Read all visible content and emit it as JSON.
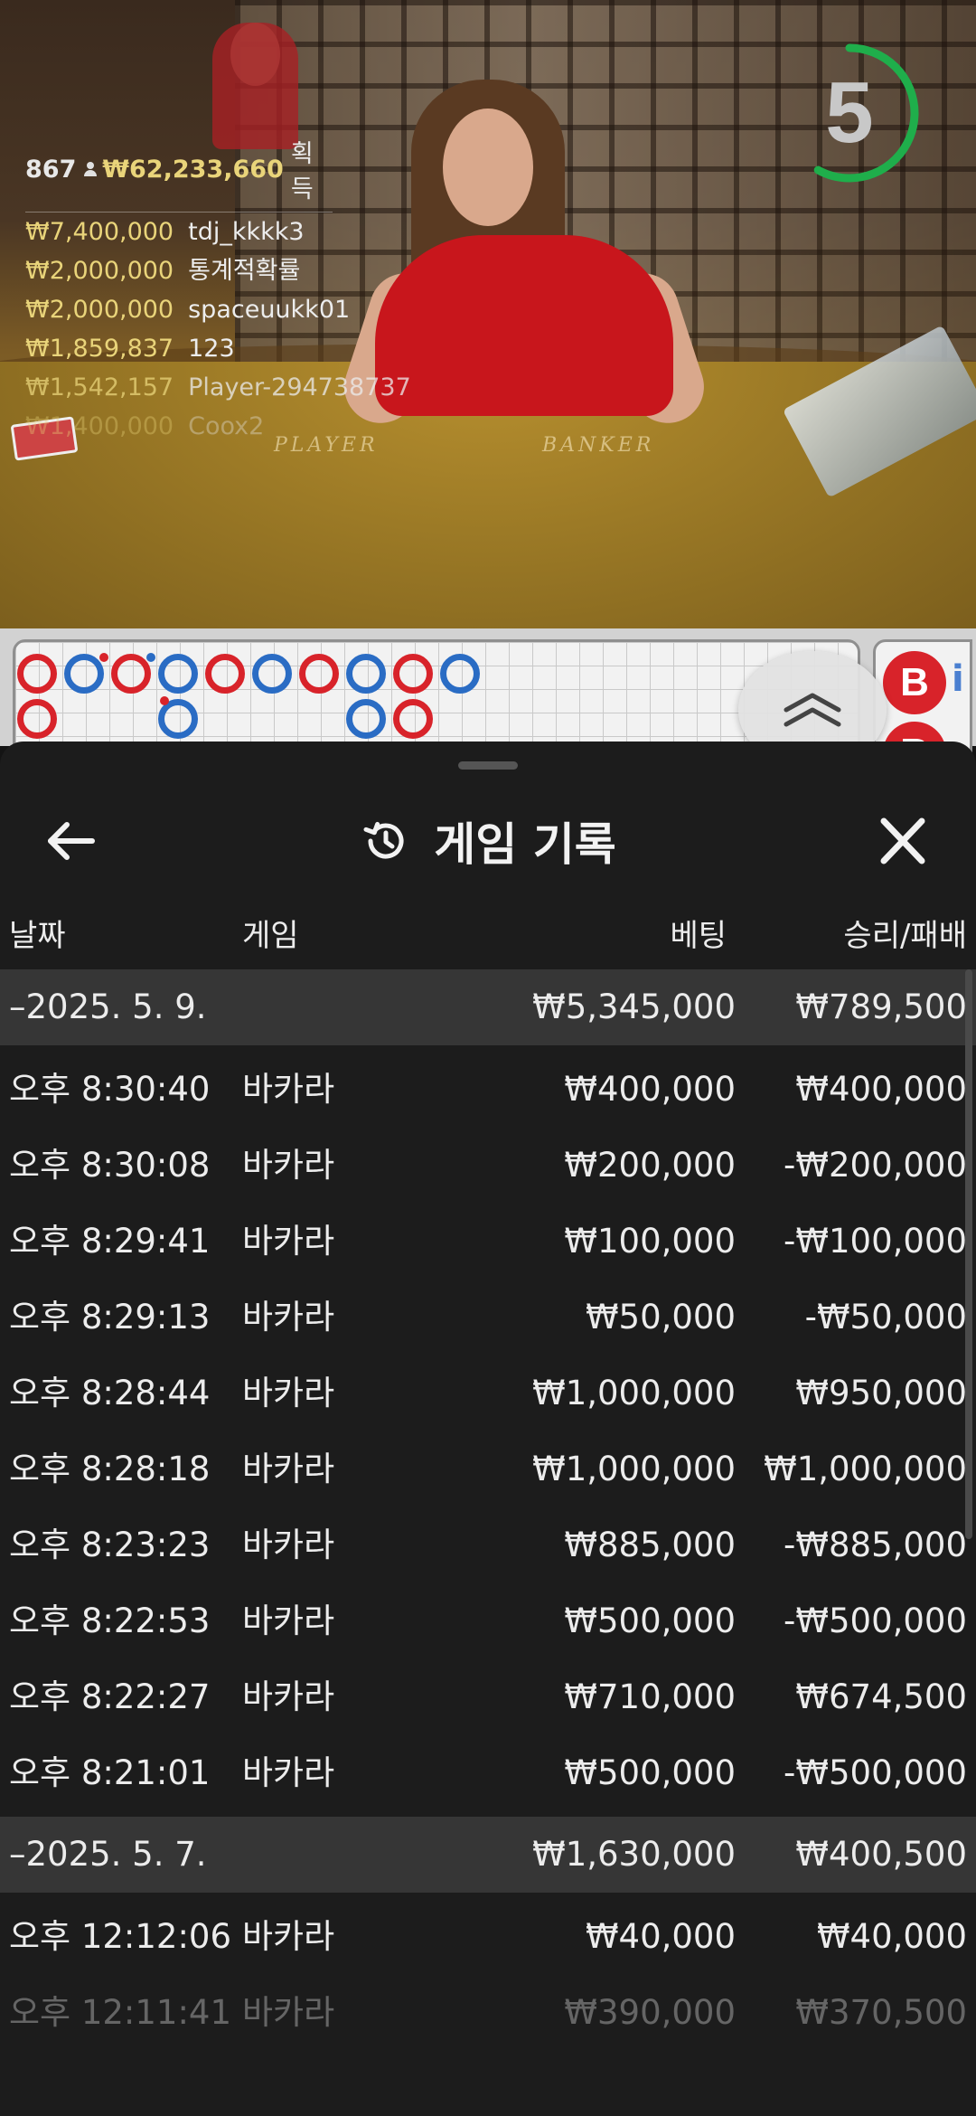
{
  "video": {
    "table_left": "PLAYER",
    "table_right": "BANKER",
    "countdown": "5",
    "countdown_progress": 0.58,
    "countdown_color": "#1fae4b"
  },
  "leaderboard": {
    "player_count": "867",
    "total": "₩62,233,660",
    "total_suffix": "획득",
    "winners": [
      {
        "amount": "₩7,400,000",
        "name": "tdj_kkkk3"
      },
      {
        "amount": "₩2,000,000",
        "name": "통계적확률"
      },
      {
        "amount": "₩2,000,000",
        "name": "spaceuukk01"
      },
      {
        "amount": "₩1,859,837",
        "name": "123"
      },
      {
        "amount": "₩1,542,157",
        "name": "Player-294738737"
      },
      {
        "amount": "₩1,400,000",
        "name": "Coox2"
      }
    ]
  },
  "roadmap": {
    "side_badge": "B",
    "banker_color": "#d8232a",
    "player_color": "#2a6cc4"
  },
  "panel": {
    "title": "게임 기록",
    "icons": {
      "back": "arrow-left-icon",
      "history": "history-icon",
      "close": "close-icon"
    },
    "columns": {
      "date": "날짜",
      "game": "게임",
      "bet": "베팅",
      "win_loss": "승리/패배"
    },
    "rows": [
      {
        "type": "date",
        "date": "–2025. 5. 9.",
        "game": "",
        "bet": "₩5,345,000",
        "win": "₩789,500"
      },
      {
        "type": "game",
        "date": "오후 8:30:40",
        "game": "바카라",
        "bet": "₩400,000",
        "win": "₩400,000"
      },
      {
        "type": "game",
        "date": "오후 8:30:08",
        "game": "바카라",
        "bet": "₩200,000",
        "win": "-₩200,000"
      },
      {
        "type": "game",
        "date": "오후 8:29:41",
        "game": "바카라",
        "bet": "₩100,000",
        "win": "-₩100,000"
      },
      {
        "type": "game",
        "date": "오후 8:29:13",
        "game": "바카라",
        "bet": "₩50,000",
        "win": "-₩50,000"
      },
      {
        "type": "game",
        "date": "오후 8:28:44",
        "game": "바카라",
        "bet": "₩1,000,000",
        "win": "₩950,000"
      },
      {
        "type": "game",
        "date": "오후 8:28:18",
        "game": "바카라",
        "bet": "₩1,000,000",
        "win": "₩1,000,000"
      },
      {
        "type": "game",
        "date": "오후 8:23:23",
        "game": "바카라",
        "bet": "₩885,000",
        "win": "-₩885,000"
      },
      {
        "type": "game",
        "date": "오후 8:22:53",
        "game": "바카라",
        "bet": "₩500,000",
        "win": "-₩500,000"
      },
      {
        "type": "game",
        "date": "오후 8:22:27",
        "game": "바카라",
        "bet": "₩710,000",
        "win": "₩674,500"
      },
      {
        "type": "game",
        "date": "오후 8:21:01",
        "game": "바카라",
        "bet": "₩500,000",
        "win": "-₩500,000"
      },
      {
        "type": "date",
        "date": "–2025. 5. 7.",
        "game": "",
        "bet": "₩1,630,000",
        "win": "₩400,500"
      },
      {
        "type": "game",
        "date": "오후 12:12:06",
        "game": "바카라",
        "bet": "₩40,000",
        "win": "₩40,000"
      },
      {
        "type": "game",
        "date": "오후 12:11:41",
        "game": "바카라",
        "bet": "₩390,000",
        "win": "₩370,500"
      }
    ]
  }
}
